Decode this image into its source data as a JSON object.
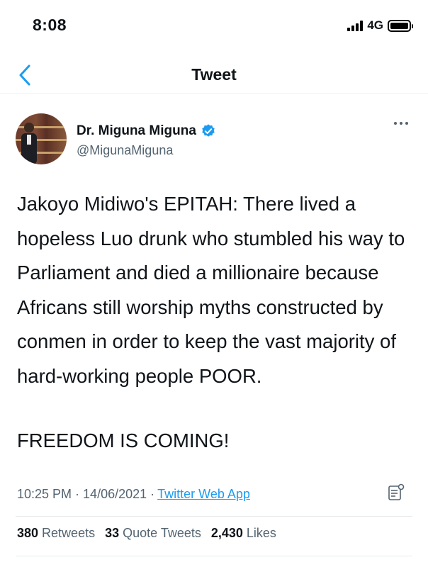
{
  "status_bar": {
    "time": "8:08",
    "network": "4G"
  },
  "nav": {
    "title": "Tweet",
    "back_icon": "chevron-left-icon"
  },
  "tweet": {
    "author_name": "Dr. Miguna Miguna",
    "handle": "@MigunaMiguna",
    "verified": true,
    "body_paragraph_1": "Jakoyo Midiwo's EPITAH: There lived a hopeless Luo drunk who stumbled his way to Parliament and died a millionaire because Africans still worship myths constructed by conmen in order to keep the vast majority of hard-working people POOR.",
    "body_paragraph_2": "FREEDOM IS COMING!",
    "time": "10:25 PM",
    "date": "14/06/2021",
    "source_app": "Twitter Web App"
  },
  "stats": {
    "retweets_count": "380",
    "retweets_label": "Retweets",
    "quote_count": "33",
    "quote_label": "Quote Tweets",
    "likes_count": "2,430",
    "likes_label": "Likes"
  },
  "colors": {
    "accent": "#1d9bf0",
    "text": "#0f1419",
    "secondary": "#536471"
  }
}
